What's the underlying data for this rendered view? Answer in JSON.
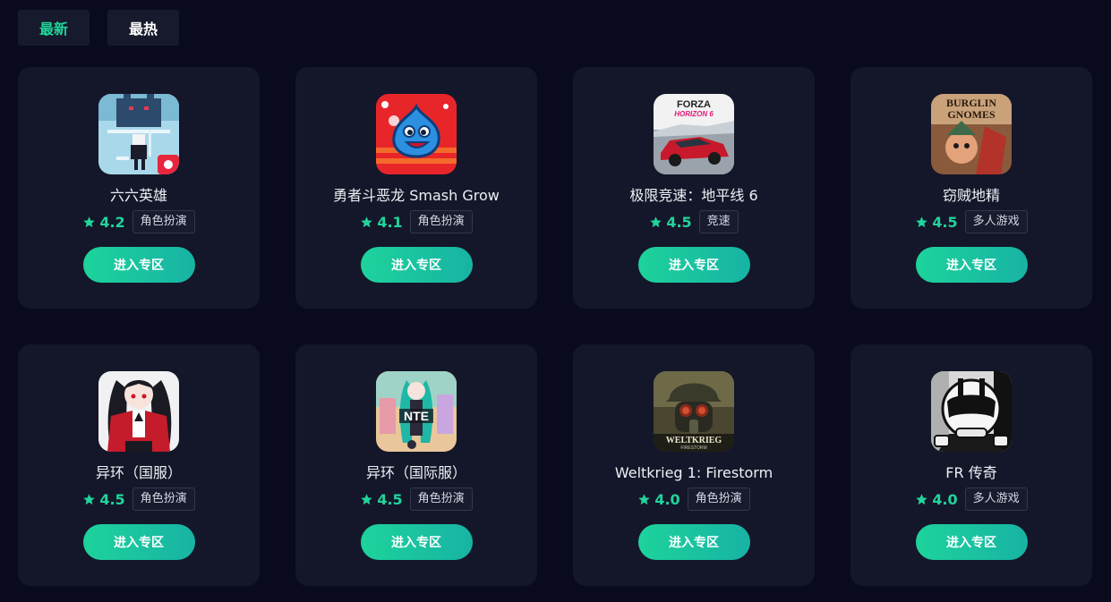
{
  "tabs": [
    {
      "label": "最新",
      "active": true
    },
    {
      "label": "最热",
      "active": false
    }
  ],
  "colors": {
    "accent": "#21d49a",
    "background": "#090b1c",
    "card": "#141729"
  },
  "games": [
    {
      "name": "六六英雄",
      "rating": "4.2",
      "genre": "角色扮演",
      "icon": "pixel-hero-icon",
      "button": "进入专区"
    },
    {
      "name": "勇者斗恶龙 Smash Grow",
      "rating": "4.1",
      "genre": "角色扮演",
      "icon": "blue-slime-icon",
      "button": "进入专区"
    },
    {
      "name": "极限竞速：地平线 6",
      "rating": "4.5",
      "genre": "竞速",
      "icon": "forza-horizon-icon",
      "button": "进入专区"
    },
    {
      "name": "窃贼地精",
      "rating": "4.5",
      "genre": "多人游戏",
      "icon": "burglin-gnomes-icon",
      "button": "进入专区"
    },
    {
      "name": "异环（国服）",
      "rating": "4.5",
      "genre": "角色扮演",
      "icon": "anime-girl-icon",
      "button": "进入专区"
    },
    {
      "name": "异环（国际服）",
      "rating": "4.5",
      "genre": "角色扮演",
      "icon": "nte-icon",
      "button": "进入专区"
    },
    {
      "name": "Weltkrieg 1: Firestorm",
      "rating": "4.0",
      "genre": "角色扮演",
      "icon": "gas-mask-soldier-icon",
      "button": "进入专区"
    },
    {
      "name": "FR 传奇",
      "rating": "4.0",
      "genre": "多人游戏",
      "icon": "racing-helmet-icon",
      "button": "进入专区"
    }
  ],
  "icon_text": {
    "forza_top": "FORZA",
    "forza_sub": "HORIZON 6",
    "burglin_1": "BURGLIN",
    "burglin_2": "GNOMES",
    "nte": "NTE",
    "weltkrieg": "WELTKRIEG",
    "firestorm": "FIRESTORM"
  }
}
